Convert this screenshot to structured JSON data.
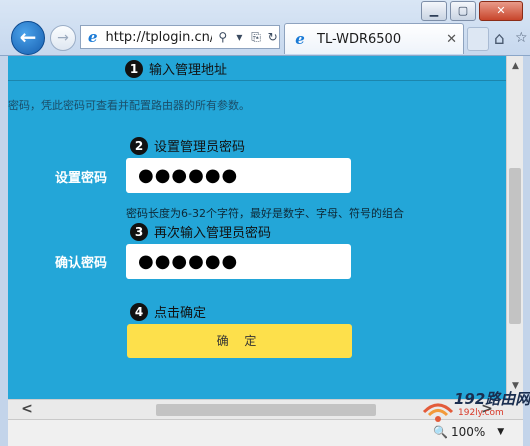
{
  "window": {
    "min_label": "▁",
    "max_label": "▢",
    "close_label": "✕"
  },
  "nav": {
    "back_icon": "back-arrow-icon",
    "forward_icon": "forward-arrow-icon"
  },
  "address_bar": {
    "url": "http://tplogin.cn/",
    "search_glyph": "⚲",
    "dropdown_glyph": "▾",
    "compat_glyph": "⎘",
    "refresh_glyph": "↻"
  },
  "tab": {
    "title": "TL-WDR6500",
    "close_glyph": "✕"
  },
  "toolbar": {
    "home_glyph": "⌂",
    "star_glyph": "☆"
  },
  "page": {
    "step1": {
      "num": "1",
      "label": "输入管理地址"
    },
    "top_hint": "密码，凭此密码可查看并配置路由器的所有参数。",
    "step2": {
      "num": "2",
      "label": "设置管理员密码"
    },
    "password_label": "设置密码",
    "password_value": "●●●●●●",
    "password_hint": "密码长度为6-32个字符，最好是数字、字母、符号的组合",
    "step3": {
      "num": "3",
      "label": "再次输入管理员密码"
    },
    "confirm_label": "确认密码",
    "confirm_value": "●●●●●●",
    "step4": {
      "num": "4",
      "label": "点击确定"
    },
    "ok_button": "确 定"
  },
  "scroll": {
    "up": "▲",
    "down": "▼",
    "left": "<",
    "right": ">"
  },
  "statusbar": {
    "zoom_icon": "🔍",
    "zoom": "100%",
    "zoom_caret": "▼"
  },
  "watermark": {
    "main": "192路由网",
    "sub": "192ly.com"
  },
  "colors": {
    "page_bg": "#23a6d8",
    "ok_button": "#fde04b",
    "ie_blue": "#1a7ad6"
  }
}
